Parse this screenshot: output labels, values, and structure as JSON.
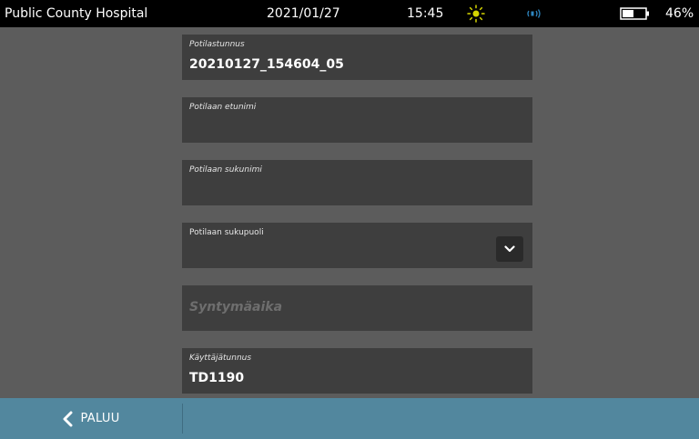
{
  "status": {
    "hospital": "Public County Hospital",
    "date": "2021/01/27",
    "time": "15:45",
    "battery_percent": "46%",
    "icons": [
      "brightness-icon",
      "volume-icon",
      "battery-icon"
    ],
    "accent_color": "#d4d400",
    "volume_color": "#2e86c1"
  },
  "form": {
    "patient_id": {
      "label": "Potilastunnus",
      "value": "20210127_154604_05"
    },
    "first_name": {
      "label": "Potilaan etunimi",
      "value": ""
    },
    "last_name": {
      "label": "Potilaan sukunimi",
      "value": ""
    },
    "gender": {
      "label": "Potilaan sukupuoli",
      "value": ""
    },
    "birthdate": {
      "placeholder": "Syntymäaika"
    },
    "user_id": {
      "label": "Käyttäjätunnus",
      "value": "TD1190"
    }
  },
  "footer": {
    "back_label": "PALUU"
  },
  "colors": {
    "background": "#5c5c5c",
    "field": "#3e3e3e",
    "footer": "#52879e"
  }
}
